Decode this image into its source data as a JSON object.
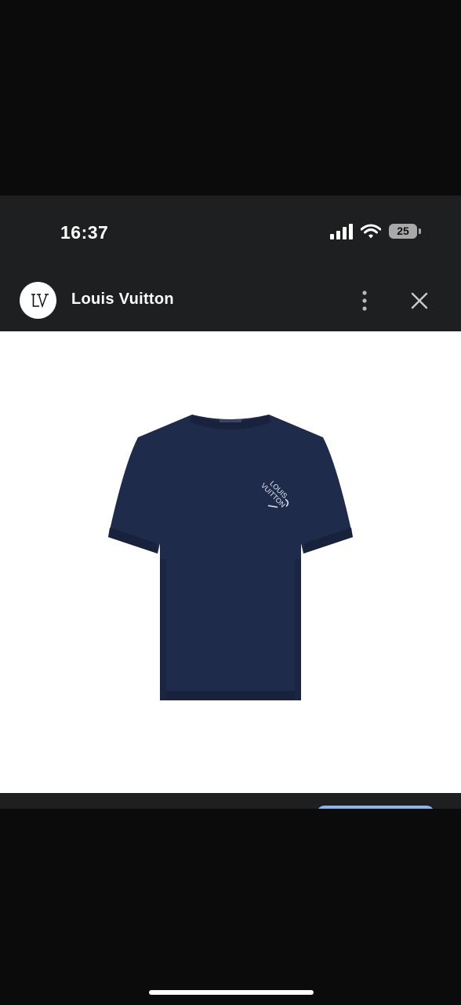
{
  "status_bar": {
    "time": "16:37",
    "battery_level": "25",
    "icons": [
      "signal-icon",
      "wifi-icon",
      "battery-icon"
    ]
  },
  "header": {
    "title": "Louis Vuitton",
    "avatar_icon": "lv-logo-icon",
    "menu_icon": "more-vertical-icon",
    "close_icon": "close-icon"
  },
  "product": {
    "image": "navy-tshirt-product-image",
    "garment_color": "#1f2b4a",
    "print_text_line1": "LOUIS",
    "print_text_line2": "VUITTON"
  },
  "colors": {
    "chrome_bg": "#1e1f21",
    "page_bg": "#0b0b0b",
    "accent_button": "#8fb3ef"
  }
}
